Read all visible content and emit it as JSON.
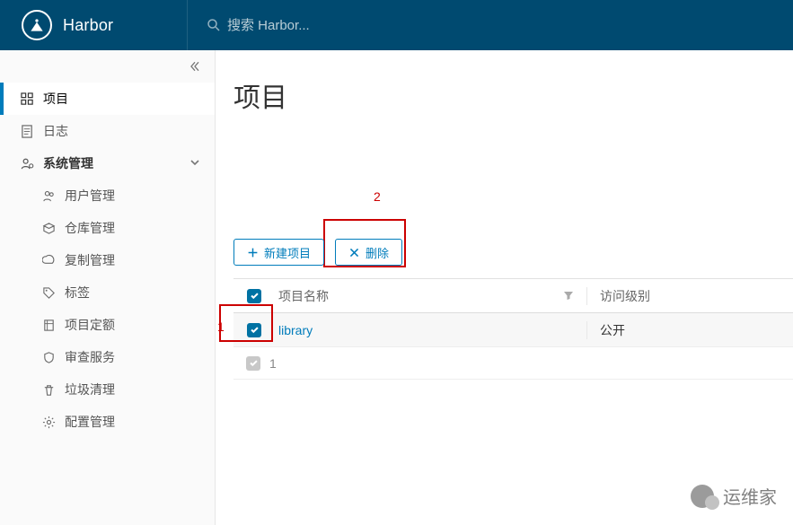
{
  "header": {
    "brand_name": "Harbor",
    "search_placeholder": "搜索 Harbor..."
  },
  "sidebar": {
    "items": [
      {
        "label": "项目",
        "icon": "projects-icon",
        "active": true
      },
      {
        "label": "日志",
        "icon": "logs-icon"
      },
      {
        "label": "系统管理",
        "icon": "admin-icon",
        "group": true,
        "expanded": true
      }
    ],
    "admin_children": [
      {
        "label": "用户管理",
        "icon": "users-icon"
      },
      {
        "label": "仓库管理",
        "icon": "repos-icon"
      },
      {
        "label": "复制管理",
        "icon": "replication-icon"
      },
      {
        "label": "标签",
        "icon": "tag-icon"
      },
      {
        "label": "项目定额",
        "icon": "quota-icon"
      },
      {
        "label": "审查服务",
        "icon": "scan-icon"
      },
      {
        "label": "垃圾清理",
        "icon": "gc-icon"
      },
      {
        "label": "配置管理",
        "icon": "config-icon"
      }
    ]
  },
  "main": {
    "title": "项目",
    "toolbar": {
      "new_label": "新建项目",
      "delete_label": "删除"
    },
    "table": {
      "columns": {
        "name": "项目名称",
        "access": "访问级别"
      },
      "rows": [
        {
          "selected": true,
          "name": "library",
          "access": "公开"
        }
      ],
      "selected_count": "1"
    }
  },
  "annotations": {
    "step1": "1",
    "step2": "2"
  },
  "watermark": {
    "text": "运维家"
  }
}
